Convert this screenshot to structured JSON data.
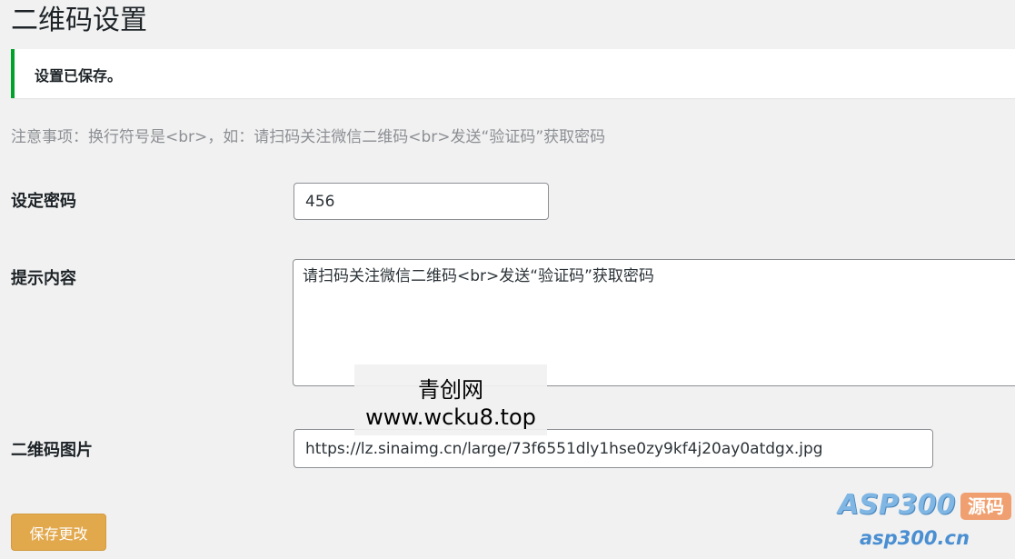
{
  "page": {
    "title": "二维码设置"
  },
  "notice": {
    "text": "设置已保存。",
    "color": "#00a32a"
  },
  "note": {
    "text": "注意事项：换行符号是<br>，如：请扫码关注微信二维码<br>发送“验证码”获取密码"
  },
  "form": {
    "password": {
      "label": "设定密码",
      "value": "456"
    },
    "hint": {
      "label": "提示内容",
      "value": "请扫码关注微信二维码<br>发送“验证码”获取密码"
    },
    "qrcode": {
      "label": "二维码图片",
      "value": "https://lz.sinaimg.cn/large/73f6551dly1hse0zy9kf4j20ay0atdgx.jpg"
    },
    "save_label": "保存更改",
    "save_color": "#e2a84c"
  },
  "watermark": {
    "line1": "青创网",
    "line2": "www.wcku8.top"
  },
  "logo": {
    "main": "ASP300",
    "badge": "源码",
    "sub": "asp300.cn"
  }
}
